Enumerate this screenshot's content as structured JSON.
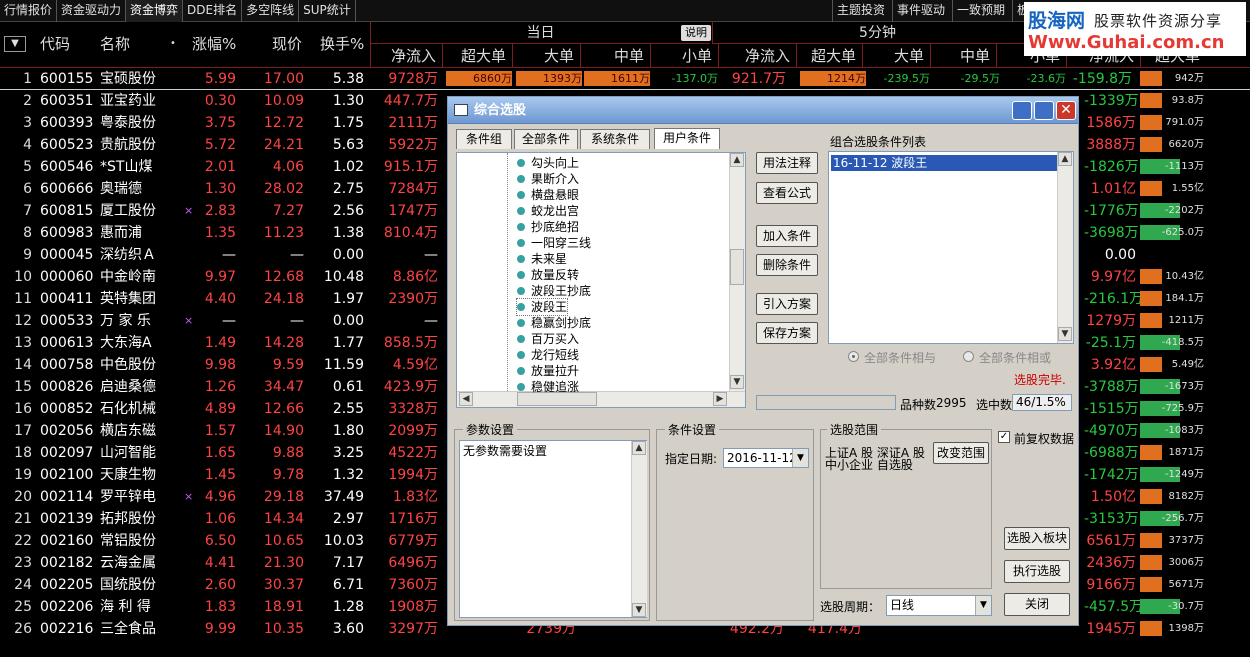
{
  "top_tabs": [
    "行情报价",
    "资金驱动力",
    "资金博弈",
    "DDE排名",
    "多空阵线",
    "SUP统计"
  ],
  "active_tab_index": 2,
  "right_tabs": [
    "主题投资",
    "事件驱动",
    "一致预期",
    "板"
  ],
  "watermark": {
    "line1": "股海网",
    "line1b": "股票软件资源分享",
    "line2": "Www.Guhai.com.cn"
  },
  "header": {
    "sort_icon": "▼",
    "code": "代码",
    "name": "名称",
    "name_dot": "•",
    "change_pct": "涨幅%",
    "price": "现价",
    "turnover": "换手%",
    "group_today": "当日",
    "group_5min": "5分钟",
    "note_button": "说明",
    "today_cols": [
      "净流入",
      "超大单",
      "大单",
      "中单",
      "小单"
    ],
    "min5_cols": [
      "净流入",
      "超大单",
      "大单",
      "中单"
    ],
    "right_cols": [
      "小单",
      "净流入",
      "超大单"
    ]
  },
  "rows": [
    {
      "idx": "1",
      "code": "600155",
      "name": "宝硕股份",
      "star": "",
      "zf": "5.99",
      "xj": "17.00",
      "hs": "5.38",
      "jl": "9728万",
      "color": "red",
      "r1": "",
      "r2": "942万",
      "r2c": "red"
    },
    {
      "idx": "2",
      "code": "600351",
      "name": "亚宝药业",
      "star": "",
      "zf": "0.30",
      "xj": "10.09",
      "hs": "1.30",
      "jl": "447.7万",
      "color": "red",
      "r1": "-1339万",
      "r2": "93.8万",
      "r2c": "red"
    },
    {
      "idx": "3",
      "code": "600393",
      "name": "粤泰股份",
      "star": "",
      "zf": "3.75",
      "xj": "12.72",
      "hs": "1.75",
      "jl": "2111万",
      "color": "red",
      "r1": "1586万",
      "r2": "791.0万",
      "r2c": "red"
    },
    {
      "idx": "4",
      "code": "600523",
      "name": "贵航股份",
      "star": "",
      "zf": "5.72",
      "xj": "24.21",
      "hs": "5.63",
      "jl": "5922万",
      "color": "red",
      "r1": "3888万",
      "r2": "6620万",
      "r2c": "red"
    },
    {
      "idx": "5",
      "code": "600546",
      "name": "*ST山煤",
      "star": "",
      "zf": "2.01",
      "xj": "4.06",
      "hs": "1.02",
      "jl": "915.1万",
      "color": "red",
      "r1": "-1826万",
      "r2": "-1113万",
      "r2c": "grn"
    },
    {
      "idx": "6",
      "code": "600666",
      "name": "奥瑞德",
      "star": "",
      "zf": "1.30",
      "xj": "28.02",
      "hs": "2.75",
      "jl": "7284万",
      "color": "red",
      "r1": "1.01亿",
      "r2": "1.55亿",
      "r2c": "red"
    },
    {
      "idx": "7",
      "code": "600815",
      "name": "厦工股份",
      "star": "×",
      "zf": "2.83",
      "xj": "7.27",
      "hs": "2.56",
      "jl": "1747万",
      "color": "red",
      "r1": "-1776万",
      "r2": "-2202万",
      "r2c": "grn"
    },
    {
      "idx": "8",
      "code": "600983",
      "name": "惠而浦",
      "star": "",
      "zf": "1.35",
      "xj": "11.23",
      "hs": "1.38",
      "jl": "810.4万",
      "color": "red",
      "r1": "-3698万",
      "r2": "-625.0万",
      "r2c": "grn"
    },
    {
      "idx": "9",
      "code": "000045",
      "name": "深纺织Ａ",
      "star": "",
      "zf": "—",
      "xj": "—",
      "hs": "0.00",
      "jl": "—",
      "color": "wht",
      "r1": "0.00",
      "r2": "",
      "r2c": "red"
    },
    {
      "idx": "10",
      "code": "000060",
      "name": "中金岭南",
      "star": "",
      "zf": "9.97",
      "xj": "12.68",
      "hs": "10.48",
      "jl": "8.86亿",
      "color": "red",
      "r1": "9.97亿",
      "r2": "10.43亿",
      "r2c": "red"
    },
    {
      "idx": "11",
      "code": "000411",
      "name": "英特集团",
      "star": "",
      "zf": "4.40",
      "xj": "24.18",
      "hs": "1.97",
      "jl": "2390万",
      "color": "red",
      "r1": "-216.1万",
      "r2": "184.1万",
      "r2c": "red"
    },
    {
      "idx": "12",
      "code": "000533",
      "name": "万 家 乐",
      "star": "×",
      "zf": "—",
      "xj": "—",
      "hs": "0.00",
      "jl": "—",
      "color": "wht",
      "r1": "1279万",
      "r2": "1211万",
      "r2c": "red"
    },
    {
      "idx": "13",
      "code": "000613",
      "name": "大东海A",
      "star": "",
      "zf": "1.49",
      "xj": "14.28",
      "hs": "1.77",
      "jl": "858.5万",
      "color": "red",
      "r1": "-25.1万",
      "r2": "-418.5万",
      "r2c": "grn"
    },
    {
      "idx": "14",
      "code": "000758",
      "name": "中色股份",
      "star": "",
      "zf": "9.98",
      "xj": "9.59",
      "hs": "11.59",
      "jl": "4.59亿",
      "color": "red",
      "r1": "3.92亿",
      "r2": "5.49亿",
      "r2c": "red"
    },
    {
      "idx": "15",
      "code": "000826",
      "name": "启迪桑德",
      "star": "",
      "zf": "1.26",
      "xj": "34.47",
      "hs": "0.61",
      "jl": "423.9万",
      "color": "red",
      "r1": "-3788万",
      "r2": "-1673万",
      "r2c": "grn"
    },
    {
      "idx": "16",
      "code": "000852",
      "name": "石化机械",
      "star": "",
      "zf": "4.89",
      "xj": "12.66",
      "hs": "2.55",
      "jl": "3328万",
      "color": "red",
      "r1": "-1515万",
      "r2": "-725.9万",
      "r2c": "grn"
    },
    {
      "idx": "17",
      "code": "002056",
      "name": "横店东磁",
      "star": "",
      "zf": "1.57",
      "xj": "14.90",
      "hs": "1.80",
      "jl": "2099万",
      "color": "red",
      "r1": "-4970万",
      "r2": "-1083万",
      "r2c": "grn"
    },
    {
      "idx": "18",
      "code": "002097",
      "name": "山河智能",
      "star": "",
      "zf": "1.65",
      "xj": "9.88",
      "hs": "3.25",
      "jl": "4522万",
      "color": "red",
      "r1": "-6988万",
      "r2": "1871万",
      "r2c": "red"
    },
    {
      "idx": "19",
      "code": "002100",
      "name": "天康生物",
      "star": "",
      "zf": "1.45",
      "xj": "9.78",
      "hs": "1.32",
      "jl": "1994万",
      "color": "red",
      "r1": "-1742万",
      "r2": "-1249万",
      "r2c": "grn"
    },
    {
      "idx": "20",
      "code": "002114",
      "name": "罗平锌电",
      "star": "×",
      "zf": "4.96",
      "xj": "29.18",
      "hs": "37.49",
      "jl": "1.83亿",
      "color": "red",
      "r1": "1.50亿",
      "r2": "8182万",
      "r2c": "red"
    },
    {
      "idx": "21",
      "code": "002139",
      "name": "拓邦股份",
      "star": "",
      "zf": "1.06",
      "xj": "14.34",
      "hs": "2.97",
      "jl": "1716万",
      "color": "red",
      "r1": "-3153万",
      "r2": "-256.7万",
      "r2c": "grn"
    },
    {
      "idx": "22",
      "code": "002160",
      "name": "常铝股份",
      "star": "",
      "zf": "6.50",
      "xj": "10.65",
      "hs": "10.03",
      "jl": "6779万",
      "color": "red",
      "r1": "6561万",
      "r2": "3737万",
      "r2c": "red"
    },
    {
      "idx": "23",
      "code": "002182",
      "name": "云海金属",
      "star": "",
      "zf": "4.41",
      "xj": "21.30",
      "hs": "7.17",
      "jl": "6496万",
      "color": "red",
      "r1": "2436万",
      "r2": "3006万",
      "r2c": "red"
    },
    {
      "idx": "24",
      "code": "002205",
      "name": "国统股份",
      "star": "",
      "zf": "2.60",
      "xj": "30.37",
      "hs": "6.71",
      "jl": "7360万",
      "color": "red",
      "r1": "9166万",
      "r2": "5671万",
      "r2c": "red"
    },
    {
      "idx": "25",
      "code": "002206",
      "name": "海 利 得",
      "star": "",
      "zf": "1.83",
      "xj": "18.91",
      "hs": "1.28",
      "jl": "1908万",
      "color": "red",
      "r1": "-457.5万",
      "r2": "-30.7万",
      "r2c": "grn"
    },
    {
      "idx": "26",
      "code": "002216",
      "name": "三全食品",
      "star": "",
      "zf": "9.99",
      "xj": "10.35",
      "hs": "3.60",
      "jl": "3297万",
      "color": "red",
      "r1": "1945万",
      "r2": "1398万",
      "r2c": "red"
    }
  ],
  "row1_extra": [
    {
      "text": "6860万",
      "color": "red"
    },
    {
      "text": "1393万",
      "color": "red"
    },
    {
      "text": "1611万",
      "color": "red"
    },
    {
      "text": "-137.0万",
      "color": "grn"
    },
    {
      "text": "921.7万",
      "color": "red"
    },
    {
      "text": "1214万",
      "color": "red"
    },
    {
      "text": "-239.5万",
      "color": "grn"
    },
    {
      "text": "-29.5万",
      "color": "grn"
    },
    {
      "text": "-23.6万",
      "color": "grn"
    },
    {
      "text": "-159.8万",
      "color": "grn"
    }
  ],
  "row26_extra": [
    {
      "text": "2739万",
      "color": "red"
    },
    {
      "text": "492.2万",
      "color": "red"
    },
    {
      "text": "417.4万",
      "color": "red"
    }
  ],
  "dialog": {
    "title": "综合选股",
    "tabs": [
      "条件组",
      "全部条件",
      "系统条件",
      "用户条件"
    ],
    "active_tab": 3,
    "tree_items": [
      "勾头向上",
      "果断介入",
      "横盘悬眼",
      "蛟龙出宫",
      "抄底绝招",
      "一阳穿三线",
      "未来星",
      "放量反转",
      "波段王抄底",
      "波段王",
      "稳赢剑抄底",
      "百万买入",
      "龙行短线",
      "放量拉升",
      "稳健追涨"
    ],
    "selected_tree_item": "波段王",
    "mid_buttons": [
      "用法注释",
      "查看公式",
      "加入条件",
      "删除条件",
      "引入方案",
      "保存方案"
    ],
    "combo_label": "组合选股条件列表",
    "combo_items": [
      "16-11-12 波段王"
    ],
    "radio_and": "全部条件相与",
    "radio_or": "全部条件相或",
    "status": "选股完毕.",
    "stock_count_label": "品种数",
    "stock_count": "2995",
    "hits_label": "选中数",
    "hits": "46/1.5%",
    "param_legend": "参数设置",
    "param_text": "无参数需要设置",
    "cond_legend": "条件设置",
    "date_label": "指定日期:",
    "date_value": "2016-11-12",
    "range_legend": "选股范围",
    "range_lines": [
      "上证A 股  深证A 股",
      "中小企业  自选股"
    ],
    "range_button": "改变范围",
    "fq_label": "前复权数据",
    "fq_checked": true,
    "to_block_button": "选股入板块",
    "run_button": "执行选股",
    "close_button": "关闭",
    "period_label": "选股周期：",
    "period_value": "日线"
  }
}
